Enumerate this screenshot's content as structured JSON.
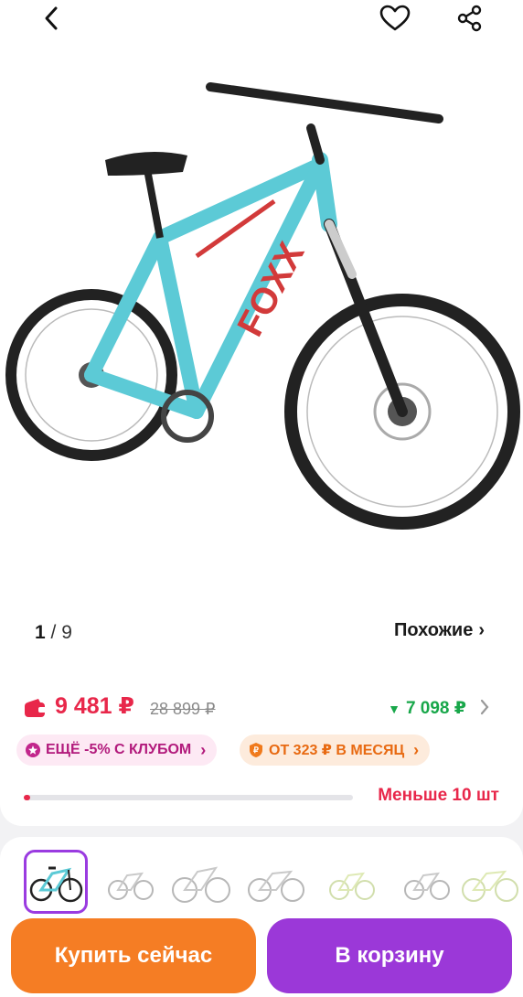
{
  "header": {
    "back_icon": "chevron-left-icon",
    "favorite_icon": "heart-icon",
    "share_icon": "share-icon"
  },
  "gallery": {
    "current": "1",
    "separator": "/",
    "total": "9",
    "similar_label": "Похожие",
    "similar_chevron": "›"
  },
  "pricing": {
    "price": "9 481 ₽",
    "old_price": "28 899 ₽",
    "bonus": "7 098 ₽",
    "bonus_marker": "▼",
    "price_color": "#e8274a",
    "bonus_color": "#18a74a"
  },
  "promos": {
    "club_label": "ЕЩЁ -5% С КЛУБОМ",
    "club_chevron": "›",
    "installment_label": "ОТ 323 ₽ В МЕСЯЦ",
    "installment_chevron": "›"
  },
  "stock": {
    "label": "Меньше 10 шт",
    "level": 0.02
  },
  "actions": {
    "buy_now": "Купить сейчас",
    "add_to_cart": "В корзину",
    "buy_color": "#f57d24",
    "cart_color": "#9b38d8"
  }
}
